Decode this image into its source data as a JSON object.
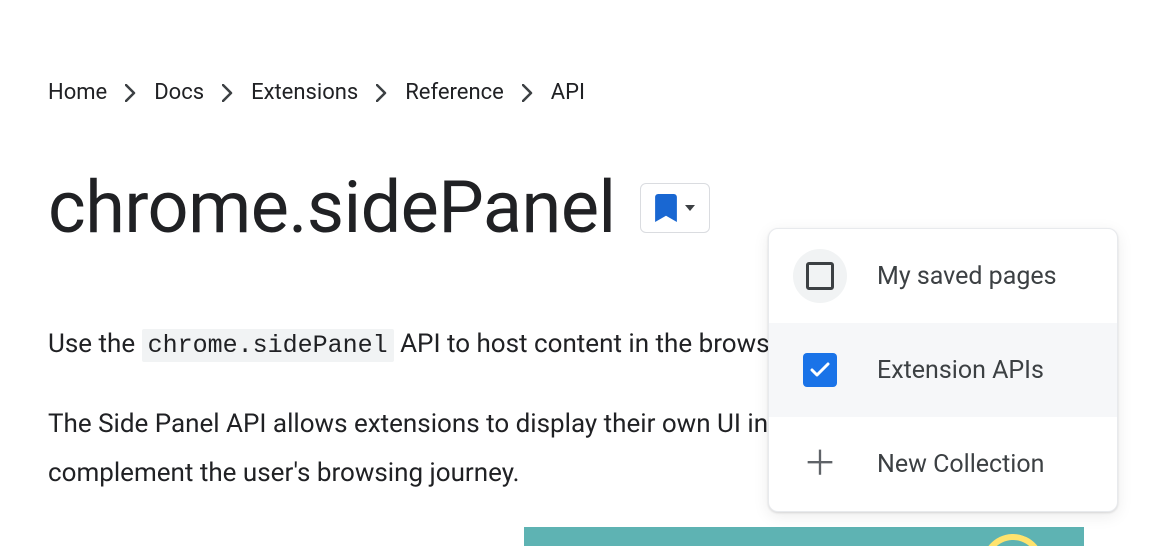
{
  "breadcrumb": {
    "items": [
      {
        "label": "Home"
      },
      {
        "label": "Docs"
      },
      {
        "label": "Extensions"
      },
      {
        "label": "Reference"
      },
      {
        "label": "API"
      }
    ]
  },
  "page": {
    "title": "chrome.sidePanel",
    "intro_prefix": "Use the ",
    "intro_code": "chrome.sidePanel",
    "intro_suffix": " API to host content in the browser's side panel alongside tl",
    "para2": "The Side Panel API allows extensions to display their own UI in the side panel, enabling p complement the user's browsing journey."
  },
  "save_dropdown": {
    "items": [
      {
        "label": "My saved pages",
        "checked": false
      },
      {
        "label": "Extension APIs",
        "checked": true
      },
      {
        "label": "New Collection",
        "action": "new"
      }
    ]
  }
}
